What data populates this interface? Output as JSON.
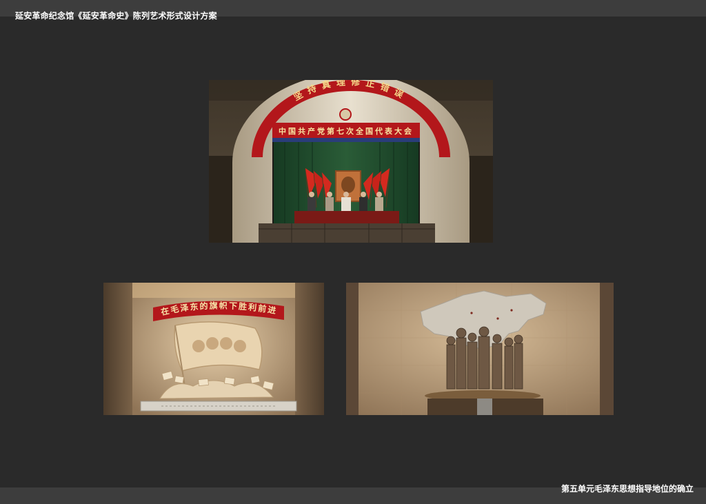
{
  "document": {
    "title": "延安革命纪念馆《延安革命史》陈列艺术形式设计方案",
    "section_title": "第五单元毛泽东思想指导地位的确立"
  },
  "panels": [
    {
      "id": "hall",
      "arch_banner": "坚持真理修正错误",
      "stage_banner": "中国共产党第七次全国代表大会"
    },
    {
      "id": "relief",
      "banner": "在毛泽东的旗帜下胜利前进"
    },
    {
      "id": "map"
    }
  ],
  "colors": {
    "background": "#2a2a2a",
    "bars": "#3d3d3d",
    "text": "#ffffff",
    "banner_red": "#b3171b",
    "curtain_green": "#1f4a2c",
    "sand": "#c9ab86"
  }
}
